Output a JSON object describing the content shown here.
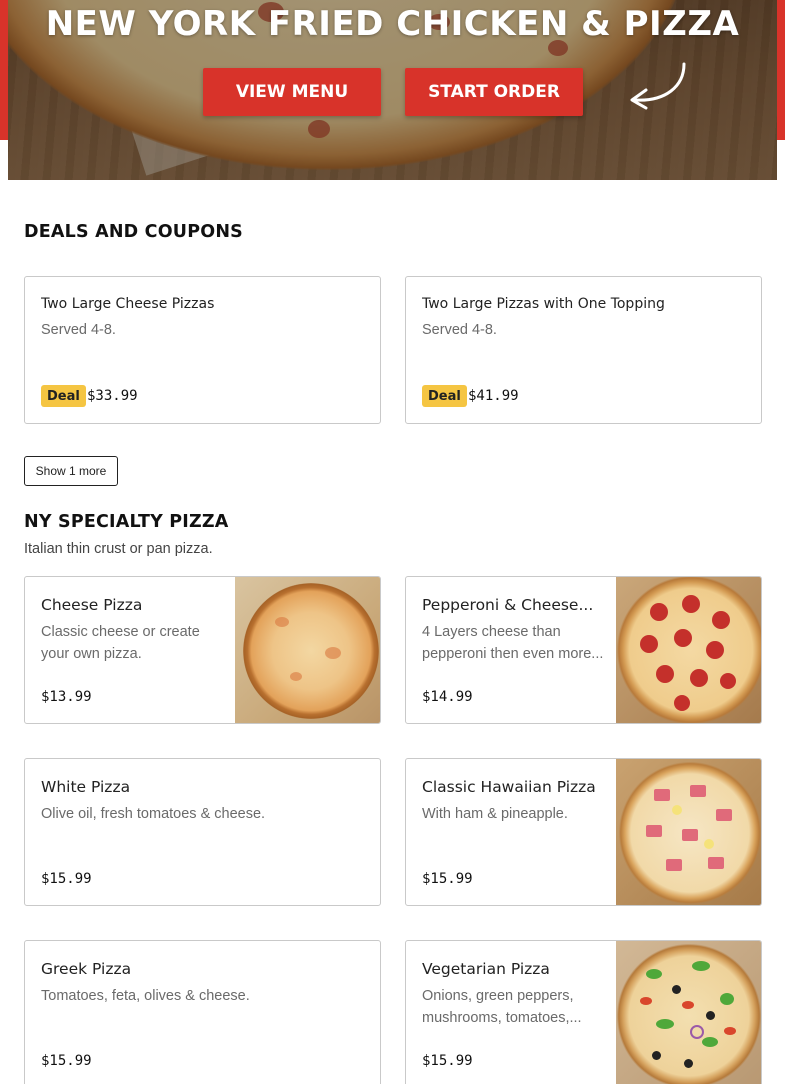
{
  "hero": {
    "title": "NEW YORK FRIED CHICKEN & PIZZA",
    "view_menu_label": "VIEW MENU",
    "start_order_label": "START ORDER"
  },
  "colors": {
    "brand_red": "#d8332a",
    "deal_badge": "#f5c542",
    "card_border": "#c9c9c9"
  },
  "deals": {
    "title": "DEALS AND COUPONS",
    "items": [
      {
        "name": "Two Large Cheese Pizzas",
        "desc": "Served 4-8.",
        "badge": "Deal",
        "price": "$33.99"
      },
      {
        "name": "Two Large Pizzas with One Topping",
        "desc": "Served 4-8.",
        "badge": "Deal",
        "price": "$41.99"
      }
    ],
    "show_more_label": "Show 1 more"
  },
  "specialty": {
    "title": "NY SPECIALTY PIZZA",
    "subtitle": "Italian thin crust or pan pizza.",
    "items": [
      {
        "name": "Cheese Pizza",
        "desc": "Classic cheese or create your own pizza.",
        "price": "$13.99",
        "image": "cheese-pizza-photo"
      },
      {
        "name": "Pepperoni & Cheese...",
        "desc": "4 Layers cheese than pepperoni then even more...",
        "price": "$14.99",
        "image": "pepperoni-pizza-photo"
      },
      {
        "name": "White Pizza",
        "desc": "Olive oil, fresh tomatoes & cheese.",
        "price": "$15.99",
        "image": ""
      },
      {
        "name": "Classic Hawaiian Pizza",
        "desc": "With ham & pineapple.",
        "price": "$15.99",
        "image": "hawaiian-pizza-photo"
      },
      {
        "name": "Greek Pizza",
        "desc": "Tomatoes, feta, olives & cheese.",
        "price": "$15.99",
        "image": ""
      },
      {
        "name": "Vegetarian Pizza",
        "desc": "Onions, green peppers, mushrooms, tomatoes,...",
        "price": "$15.99",
        "image": "vegetarian-pizza-photo"
      }
    ]
  }
}
